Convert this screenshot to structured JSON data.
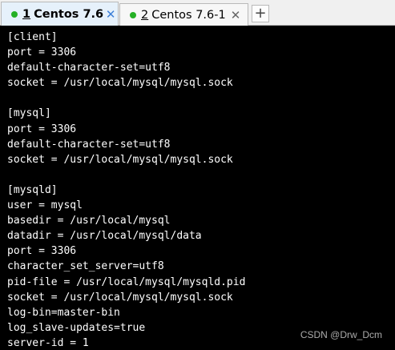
{
  "tabs": [
    {
      "number": "1",
      "title": "Centos 7.6",
      "active": true,
      "close": "✕"
    },
    {
      "number": "2",
      "title": "Centos 7.6-1",
      "active": false,
      "close": "✕"
    }
  ],
  "new_tab_label": "+",
  "colors": {
    "status_dot": "#25b025",
    "terminal_bg": "#000000",
    "terminal_fg": "#ffffff"
  },
  "terminal": {
    "lines": [
      "[client]",
      "port = 3306",
      "default-character-set=utf8",
      "socket = /usr/local/mysql/mysql.sock",
      "",
      "[mysql]",
      "port = 3306",
      "default-character-set=utf8",
      "socket = /usr/local/mysql/mysql.sock",
      "",
      "[mysqld]",
      "user = mysql",
      "basedir = /usr/local/mysql",
      "datadir = /usr/local/mysql/data",
      "port = 3306",
      "character_set_server=utf8",
      "pid-file = /usr/local/mysql/mysqld.pid",
      "socket = /usr/local/mysql/mysql.sock",
      "log-bin=master-bin",
      "log_slave-updates=true",
      "server-id = 1"
    ]
  },
  "watermark": "CSDN @Drw_Dcm"
}
